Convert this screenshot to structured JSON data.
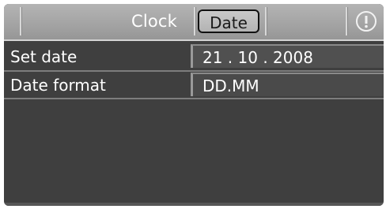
{
  "header": {
    "tabs": [
      {
        "label": "Clock",
        "selected": false
      },
      {
        "label": "Date",
        "selected": true
      }
    ],
    "info_icon": "info-icon"
  },
  "settings": {
    "rows": [
      {
        "label": "Set date",
        "value": "21 . 10 . 2008"
      },
      {
        "label": "Date format",
        "value": "DD.MM"
      }
    ]
  },
  "colors": {
    "background": "#3f3f3f",
    "header": "#a8a8a8",
    "selected_tab_border": "#111111",
    "text": "#ffffff"
  }
}
